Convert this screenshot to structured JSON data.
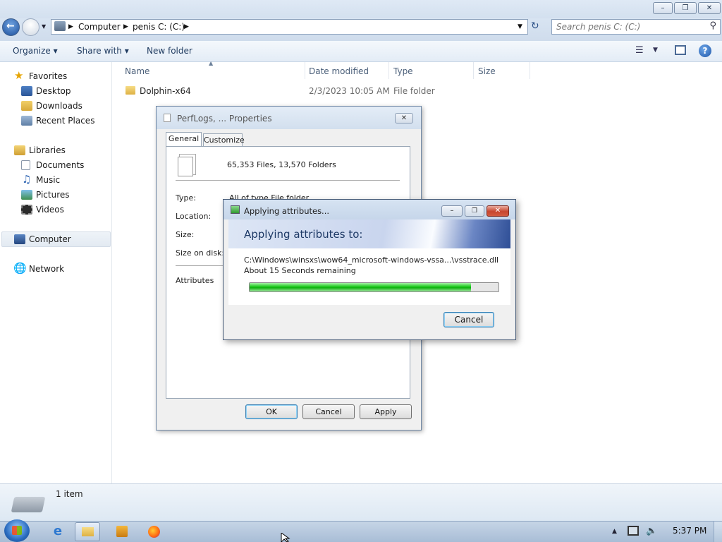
{
  "address": {
    "crumbs": [
      "Computer",
      "penis C: (C:)"
    ]
  },
  "search": {
    "placeholder": "Search penis C: (C:)"
  },
  "toolbar": {
    "organize": "Organize",
    "share_with": "Share with",
    "new_folder": "New folder"
  },
  "nav": {
    "favorites": "Favorites",
    "desktop": "Desktop",
    "downloads": "Downloads",
    "recent_places": "Recent Places",
    "libraries": "Libraries",
    "documents": "Documents",
    "music": "Music",
    "pictures": "Pictures",
    "videos": "Videos",
    "computer": "Computer",
    "network": "Network"
  },
  "columns": {
    "name": "Name",
    "date_modified": "Date modified",
    "type": "Type",
    "size": "Size"
  },
  "files": [
    {
      "name": "Dolphin-x64",
      "date": "2/3/2023 10:05 AM",
      "type": "File folder"
    }
  ],
  "status": {
    "count": "1 item"
  },
  "props_dialog": {
    "title": "PerfLogs, ... Properties",
    "tabs": [
      "General",
      "Customize"
    ],
    "summary": "65,353 Files, 13,570 Folders",
    "labels": {
      "type": "Type:",
      "location": "Location:",
      "size": "Size:",
      "size_on_disk": "Size on disk:",
      "attributes": "Attributes"
    },
    "type_value": "All of type File folder",
    "buttons": {
      "ok": "OK",
      "cancel": "Cancel",
      "apply": "Apply"
    }
  },
  "apply_dialog": {
    "title": "Applying attributes...",
    "heading": "Applying attributes to:",
    "path": "C:\\Windows\\winsxs\\wow64_microsoft-windows-vssa...\\vsstrace.dll",
    "time_remaining": "About 15 Seconds remaining",
    "progress": 0.89,
    "cancel": "Cancel"
  },
  "taskbar": {
    "clock": "5:37 PM"
  },
  "colors": {
    "accent": "#1f6fbf",
    "progress": "#18c818"
  }
}
